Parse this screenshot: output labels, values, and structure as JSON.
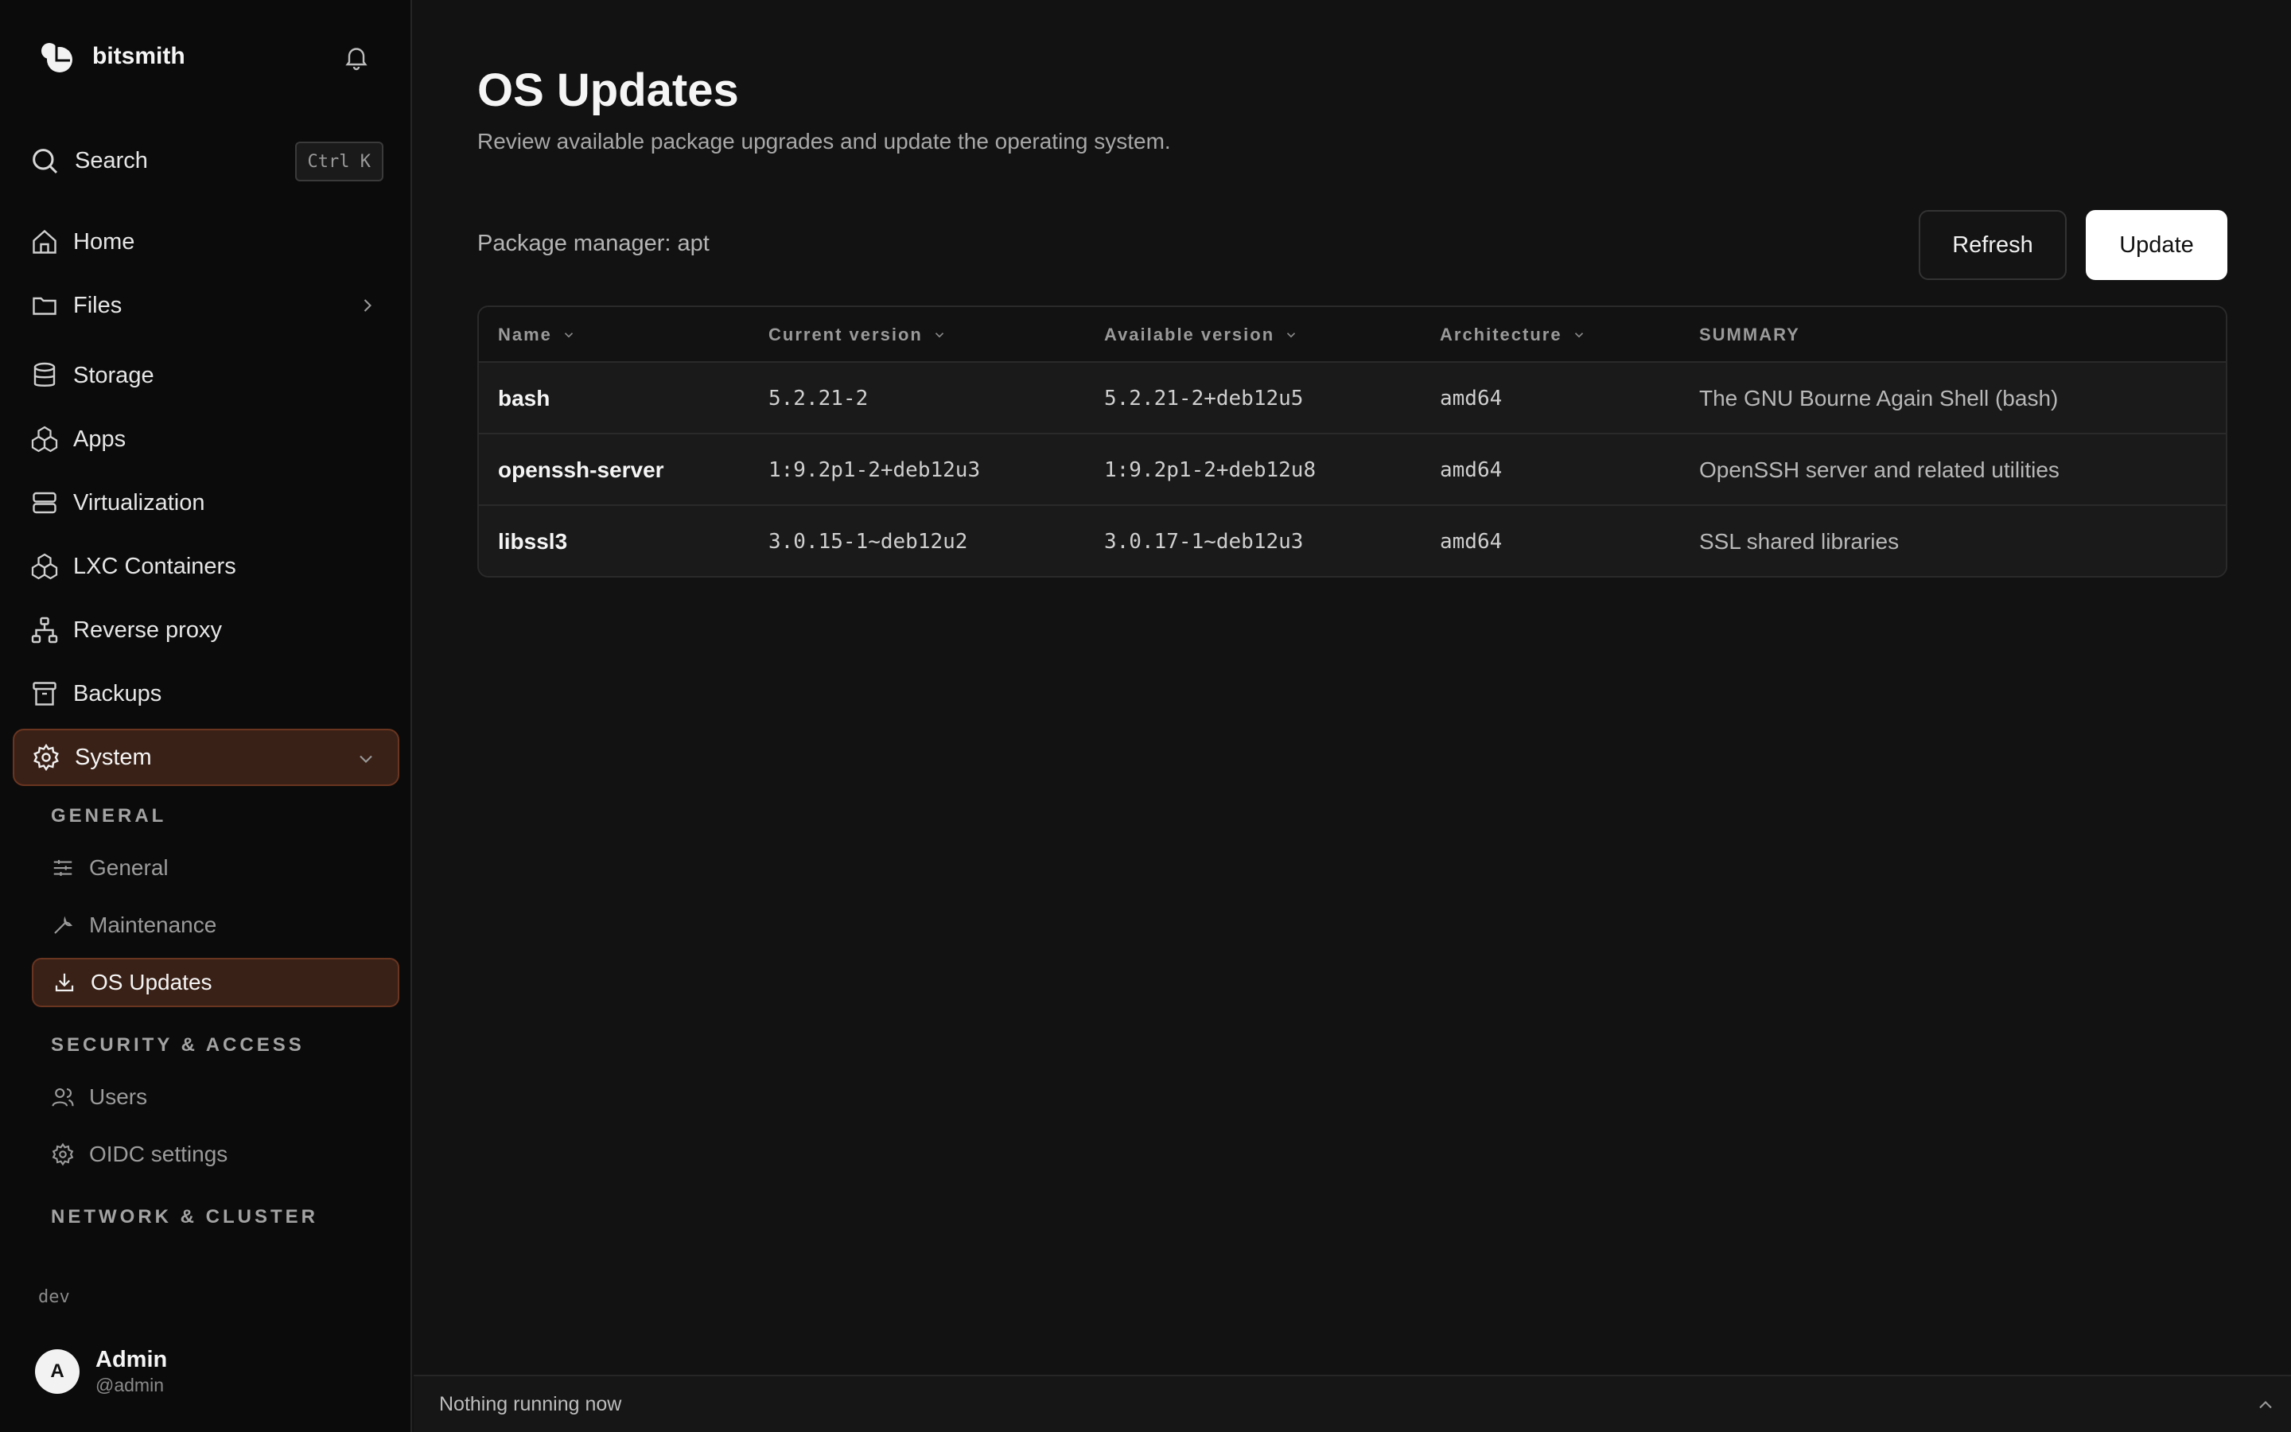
{
  "brand": {
    "name": "bitsmith"
  },
  "search": {
    "label": "Search",
    "shortcut": "Ctrl K"
  },
  "sidebar": {
    "items": [
      {
        "label": "Home",
        "icon": "home-icon"
      },
      {
        "label": "Files",
        "icon": "folder-icon"
      },
      {
        "label": "Storage",
        "icon": "database-icon"
      },
      {
        "label": "Apps",
        "icon": "boxes-icon"
      },
      {
        "label": "Virtualization",
        "icon": "server-icon"
      },
      {
        "label": "LXC Containers",
        "icon": "boxes-icon"
      },
      {
        "label": "Reverse proxy",
        "icon": "network-icon"
      },
      {
        "label": "Backups",
        "icon": "archive-icon"
      },
      {
        "label": "System",
        "icon": "gear-icon"
      }
    ],
    "sections": [
      {
        "title": "GENERAL"
      },
      {
        "title": "SECURITY & ACCESS"
      },
      {
        "title": "NETWORK & CLUSTER"
      }
    ],
    "sub_items": [
      {
        "label": "General",
        "icon": "sliders-icon"
      },
      {
        "label": "Maintenance",
        "icon": "wrench-icon"
      },
      {
        "label": "OS Updates",
        "icon": "download-icon"
      },
      {
        "label": "Users",
        "icon": "users-icon"
      },
      {
        "label": "OIDC settings",
        "icon": "gear-icon"
      }
    ],
    "env": "dev"
  },
  "user": {
    "initial": "A",
    "name": "Admin",
    "handle": "@admin"
  },
  "page": {
    "title": "OS Updates",
    "subtitle": "Review available package upgrades and update the operating system.",
    "package_manager": "Package manager: apt",
    "refresh_label": "Refresh",
    "update_label": "Update"
  },
  "table": {
    "columns": [
      "Name",
      "Current version",
      "Available version",
      "Architecture",
      "SUMMARY"
    ],
    "rows": [
      {
        "name": "bash",
        "current": "5.2.21-2",
        "available": "5.2.21-2+deb12u5",
        "arch": "amd64",
        "summary": "The GNU Bourne Again Shell (bash)"
      },
      {
        "name": "openssh-server",
        "current": "1:9.2p1-2+deb12u3",
        "available": "1:9.2p1-2+deb12u8",
        "arch": "amd64",
        "summary": "OpenSSH server and related utilities"
      },
      {
        "name": "libssl3",
        "current": "3.0.15-1~deb12u2",
        "available": "3.0.17-1~deb12u3",
        "arch": "amd64",
        "summary": "SSL shared libraries"
      }
    ]
  },
  "status": {
    "text": "Nothing running now"
  },
  "colors": {
    "accent_bg": "#3a2117",
    "accent_border": "#6a3520",
    "background": "#121212",
    "sidebar": "#0b0b0b"
  }
}
